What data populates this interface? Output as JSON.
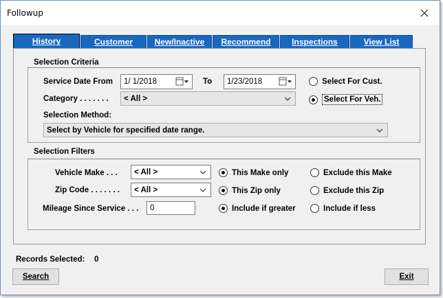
{
  "window": {
    "title": "Followup",
    "close_glyph": "✕"
  },
  "tabs": [
    {
      "label": "History",
      "active": true
    },
    {
      "label": "Customer",
      "active": false
    },
    {
      "label": "New/Inactive",
      "active": false
    },
    {
      "label": "Recommend",
      "active": false
    },
    {
      "label": "Inspections",
      "active": false
    },
    {
      "label": "View List",
      "active": false
    }
  ],
  "criteria": {
    "section_title": "Selection Criteria",
    "service_date_from_label": "Service Date From",
    "date_from": "1/  1/2018",
    "to_label": "To",
    "date_to": "1/23/2018",
    "select_for_cust": "Select For Cust.",
    "select_for_veh": "Select For Veh.",
    "category_label": "Category . . . . . . .",
    "category_value": "< All >",
    "selection_method_label": "Selection Method:",
    "selection_method_value": "Select by Vehicle for specified date range."
  },
  "filters": {
    "section_title": "Selection Filters",
    "vehicle_make_label": "Vehicle Make . . .",
    "vehicle_make_value": "< All >",
    "this_make_only": "This Make only",
    "exclude_make": "Exclude this Make",
    "zip_label": "Zip Code . . . . . . .",
    "zip_value": "< All >",
    "this_zip_only": "This Zip only",
    "exclude_zip": "Exclude this Zip",
    "mileage_label": "Mileage Since Service . . .",
    "mileage_value": "0",
    "include_greater": "Include if greater",
    "include_less": "Include if less"
  },
  "footer": {
    "records_label": "Records Selected:",
    "records_count": "0",
    "search_label": "Search",
    "exit_label": "Exit"
  }
}
